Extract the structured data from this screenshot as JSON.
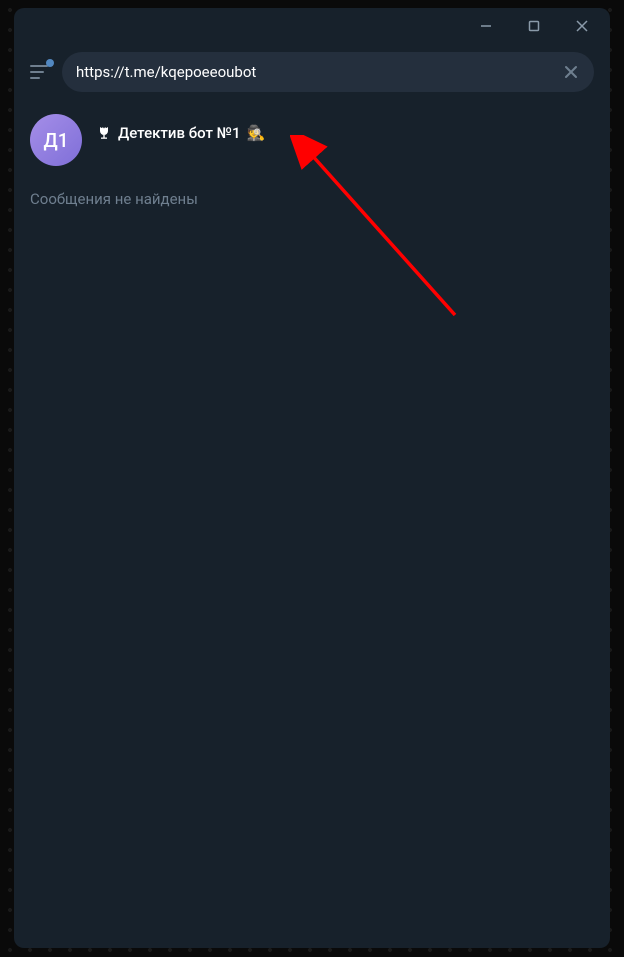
{
  "search": {
    "value": "https://t.me/kqepoeeoubot"
  },
  "chat": {
    "avatar_text": "Д1",
    "title": "Детектив бот №1",
    "emoji": "🕵️"
  },
  "messages": {
    "empty_text": "Сообщения не найдены"
  }
}
